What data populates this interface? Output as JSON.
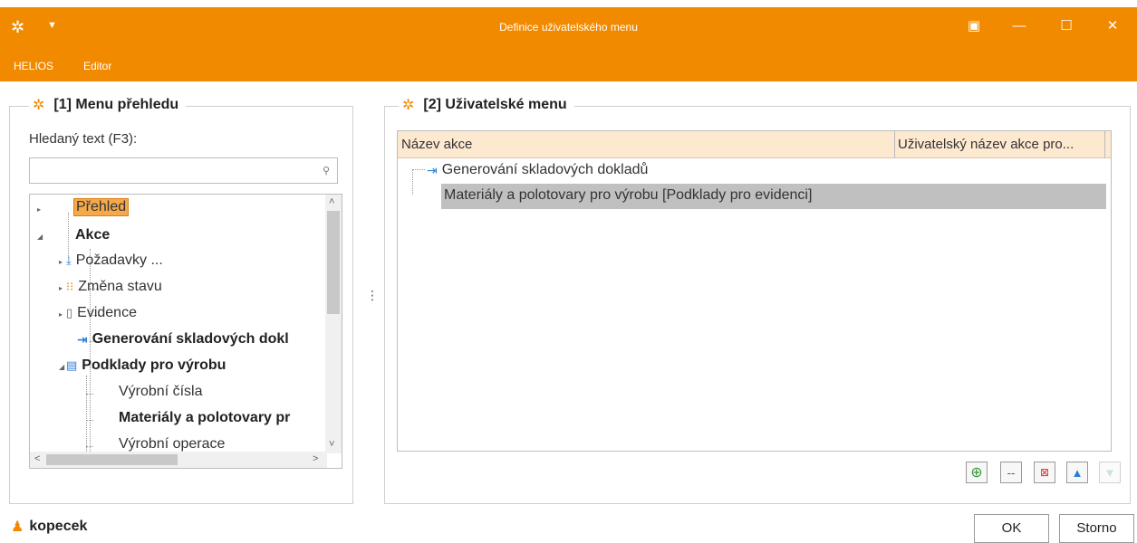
{
  "window": {
    "title": "Definice uživatelského menu",
    "accent": "#f28a00"
  },
  "menubar": {
    "items": [
      "HELIOS",
      "Editor"
    ]
  },
  "left_panel": {
    "title": "[1] Menu přehledu",
    "search_label": "Hledaný text (F3):",
    "search_value": "",
    "tree": [
      {
        "label": "Přehled",
        "bold": false,
        "selected": true
      },
      {
        "label": "Akce",
        "bold": true
      },
      {
        "label": "Požadavky ...",
        "icon": "requests-icon"
      },
      {
        "label": "Změna stavu",
        "icon": "state-change-icon"
      },
      {
        "label": "Evidence",
        "icon": "evidence-icon"
      },
      {
        "label": "Generování skladových dokl",
        "bold": true,
        "icon": "generate-docs-icon"
      },
      {
        "label": "Podklady pro výrobu",
        "bold": true,
        "icon": "production-docs-icon"
      },
      {
        "label": "Výrobní čísla"
      },
      {
        "label": "Materiály a polotovary pr",
        "bold": true
      },
      {
        "label": "Výrobní operace"
      }
    ]
  },
  "right_panel": {
    "title": "[2] Uživatelské menu",
    "columns": [
      "Název akce",
      "Uživatelský název akce pro..."
    ],
    "rows": [
      {
        "label": "Generování skladových dokladů",
        "icon": "generate-docs-icon"
      },
      {
        "label": "Materiály a polotovary pro výrobu [Podklady pro evidenci]",
        "selected": true
      }
    ]
  },
  "footer": {
    "user": "kopecek",
    "ok_label": "OK",
    "cancel_label": "Storno"
  }
}
